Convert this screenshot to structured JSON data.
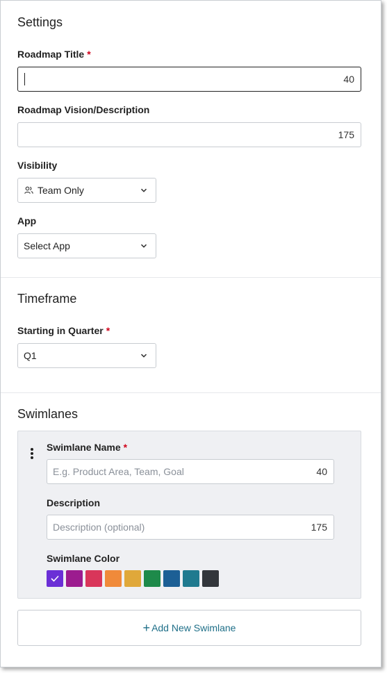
{
  "settings": {
    "heading": "Settings",
    "title_label": "Roadmap Title",
    "title_required": "*",
    "title_value": "",
    "title_count": "40",
    "vision_label": "Roadmap Vision/Description",
    "vision_value": "",
    "vision_count": "175",
    "visibility_label": "Visibility",
    "visibility_value": "Team Only",
    "visibility_icon": "people-icon",
    "app_label": "App",
    "app_value": "Select App"
  },
  "timeframe": {
    "heading": "Timeframe",
    "quarter_label": "Starting in Quarter",
    "quarter_required": "*",
    "quarter_value": "Q1"
  },
  "swimlanes": {
    "heading": "Swimlanes",
    "name_label": "Swimlane Name",
    "name_required": "*",
    "name_placeholder": "E.g. Product Area, Team, Goal",
    "name_count": "40",
    "description_label": "Description",
    "description_placeholder": "Description (optional)",
    "description_count": "175",
    "color_label": "Swimlane Color",
    "colors": [
      "#6b2fd6",
      "#9c1c8f",
      "#d9365a",
      "#f08a3a",
      "#e0a83a",
      "#1e8a4a",
      "#1c5f95",
      "#1f7a8f",
      "#33363b"
    ],
    "selected_color_index": 0,
    "add_button_label": "Add New Swimlane",
    "add_button_icon": "+"
  }
}
